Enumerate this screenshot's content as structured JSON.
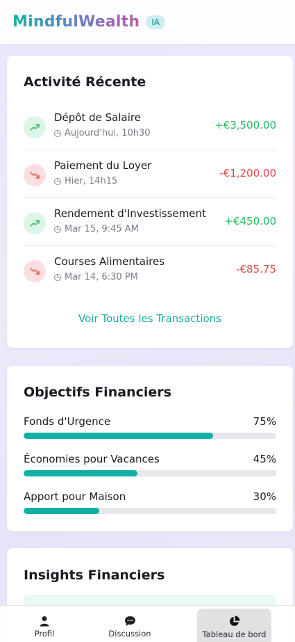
{
  "header": {
    "brand": "MindfulWealth",
    "badge": "IA"
  },
  "activity": {
    "title": "Activité Récente",
    "transactions": [
      {
        "title": "Dépôt de Salaire",
        "time": "Aujourd'hui, 10h30",
        "amount": "+€3,500.00",
        "direction": "up"
      },
      {
        "title": "Paiement du Loyer",
        "time": "Hier, 14h15",
        "amount": "-€1,200.00",
        "direction": "down"
      },
      {
        "title": "Rendement d'Investissement",
        "time": "Mar 15, 9:45 AM",
        "amount": "+€450.00",
        "direction": "up"
      },
      {
        "title": "Courses Alimentaires",
        "time": "Mar 14, 6:30 PM",
        "amount": "-€85.75",
        "direction": "down"
      }
    ],
    "see_all": "Voir Toutes les Transactions"
  },
  "goals": {
    "title": "Objectifs Financiers",
    "items": [
      {
        "label": "Fonds d'Urgence",
        "percent": "75%",
        "progress": 0.75
      },
      {
        "label": "Économies pour Vacances",
        "percent": "45%",
        "progress": 0.45
      },
      {
        "label": "Apport pour Maison",
        "percent": "30%",
        "progress": 0.3
      }
    ]
  },
  "insights": {
    "title": "Insights Financiers"
  },
  "nav": {
    "items": [
      {
        "label": "Profil",
        "icon": "user-icon"
      },
      {
        "label": "Discussion",
        "icon": "chat-icon"
      },
      {
        "label": "Tableau de bord",
        "icon": "pie-chart-icon",
        "active": true
      }
    ]
  },
  "colors": {
    "accent": "#17aaa0",
    "positive": "#22b85a",
    "negative": "#e34646",
    "progress": "#12b0a3"
  }
}
